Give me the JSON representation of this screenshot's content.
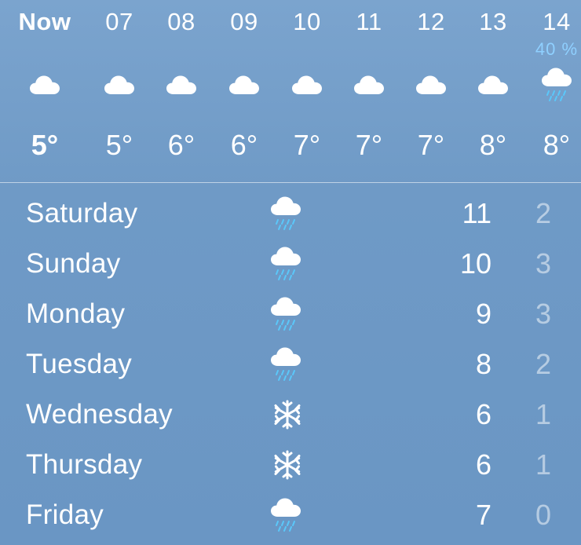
{
  "hourly": [
    {
      "time": "Now",
      "temp": "5°",
      "icon": "cloud-icon",
      "precip": ""
    },
    {
      "time": "07",
      "temp": "5°",
      "icon": "cloud-icon",
      "precip": ""
    },
    {
      "time": "08",
      "temp": "6°",
      "icon": "cloud-icon",
      "precip": ""
    },
    {
      "time": "09",
      "temp": "6°",
      "icon": "cloud-icon",
      "precip": ""
    },
    {
      "time": "10",
      "temp": "7°",
      "icon": "cloud-icon",
      "precip": ""
    },
    {
      "time": "11",
      "temp": "7°",
      "icon": "cloud-icon",
      "precip": ""
    },
    {
      "time": "12",
      "temp": "7°",
      "icon": "cloud-icon",
      "precip": ""
    },
    {
      "time": "13",
      "temp": "8°",
      "icon": "cloud-icon",
      "precip": ""
    },
    {
      "time": "14",
      "temp": "8°",
      "icon": "rain-cloud-icon",
      "precip": "40 %"
    }
  ],
  "daily": [
    {
      "day": "Saturday",
      "icon": "rain-cloud-icon",
      "high": "11",
      "low": "2"
    },
    {
      "day": "Sunday",
      "icon": "rain-cloud-icon",
      "high": "10",
      "low": "3"
    },
    {
      "day": "Monday",
      "icon": "rain-cloud-icon",
      "high": "9",
      "low": "3"
    },
    {
      "day": "Tuesday",
      "icon": "rain-cloud-icon",
      "high": "8",
      "low": "2"
    },
    {
      "day": "Wednesday",
      "icon": "snowflake-icon",
      "high": "6",
      "low": "1"
    },
    {
      "day": "Thursday",
      "icon": "snowflake-icon",
      "high": "6",
      "low": "1"
    },
    {
      "day": "Friday",
      "icon": "rain-cloud-icon",
      "high": "7",
      "low": "0"
    }
  ],
  "colors": {
    "background": "#6f9ac6",
    "precip_chance": "#8fd0ff",
    "rain_drops": "#5ac8fa"
  }
}
